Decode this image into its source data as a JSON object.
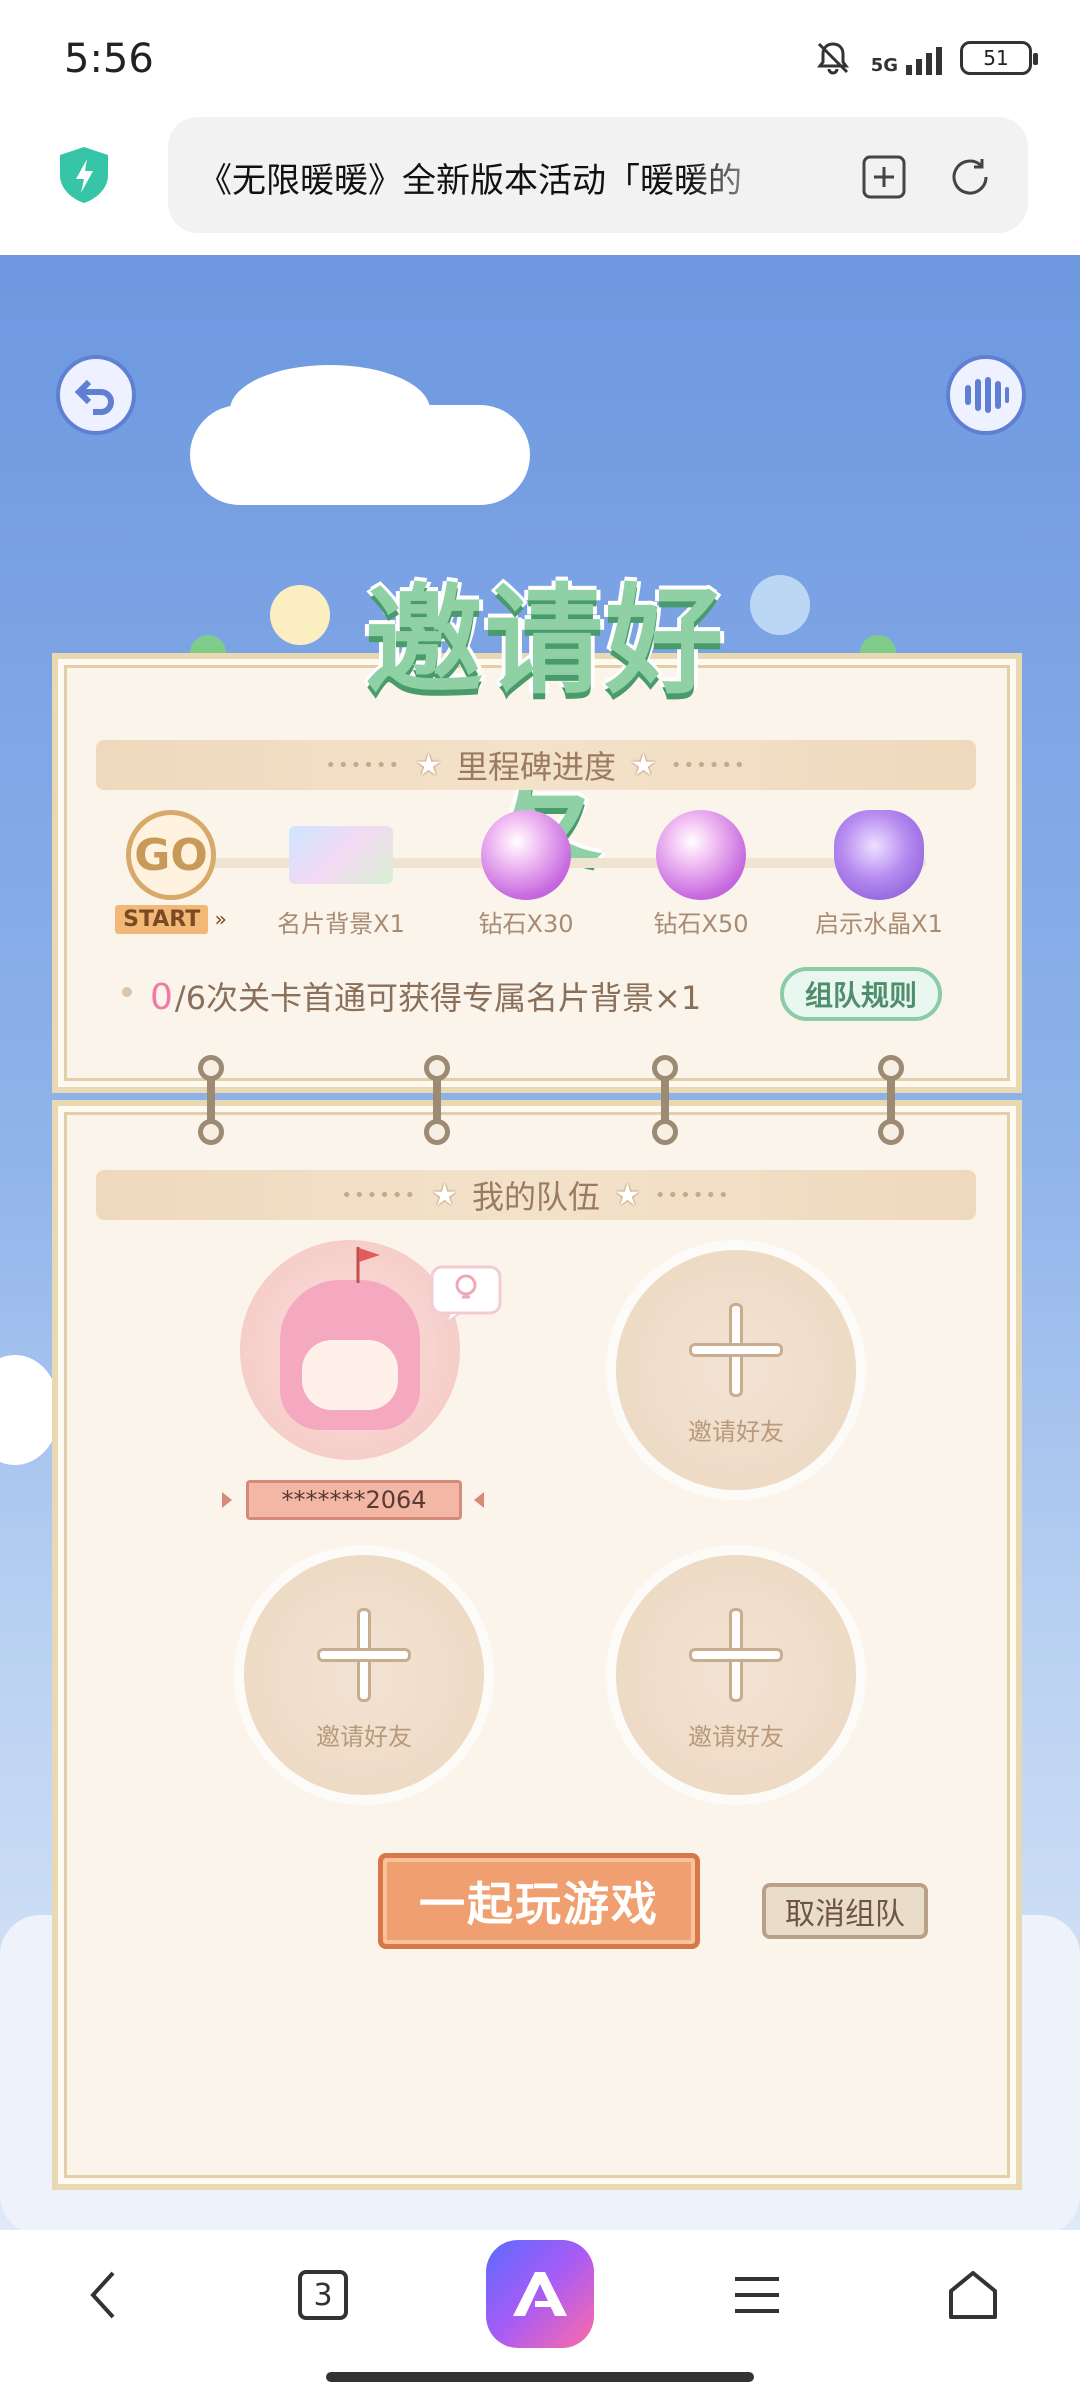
{
  "status_bar": {
    "time": "5:56",
    "network": "5G",
    "battery": "51"
  },
  "browser": {
    "url_title": "《无限暖暖》全新版本活动「暖暖的",
    "shield_color": "#36c5a6"
  },
  "game": {
    "title": "邀请好友",
    "milestone_header": "里程碑进度",
    "milestones": [
      {
        "label": "START",
        "icon": "go-icon",
        "badge": "GO"
      },
      {
        "label": "名片背景X1",
        "icon": "card-background-icon"
      },
      {
        "label": "钻石X30",
        "icon": "diamond-icon"
      },
      {
        "label": "钻石X50",
        "icon": "diamond-icon"
      },
      {
        "label": "启示水晶X1",
        "icon": "crystal-icon"
      }
    ],
    "progress": {
      "current": "0",
      "text": "/6次关卡首通可获得专属名片背景×1"
    },
    "rules_button": "组队规则",
    "team_header": "我的队伍",
    "player_name": "*******2064",
    "invite_label": "邀请好友",
    "play_button": "一起玩游戏",
    "cancel_button": "取消组队"
  },
  "nav": {
    "tab_count": "3"
  }
}
